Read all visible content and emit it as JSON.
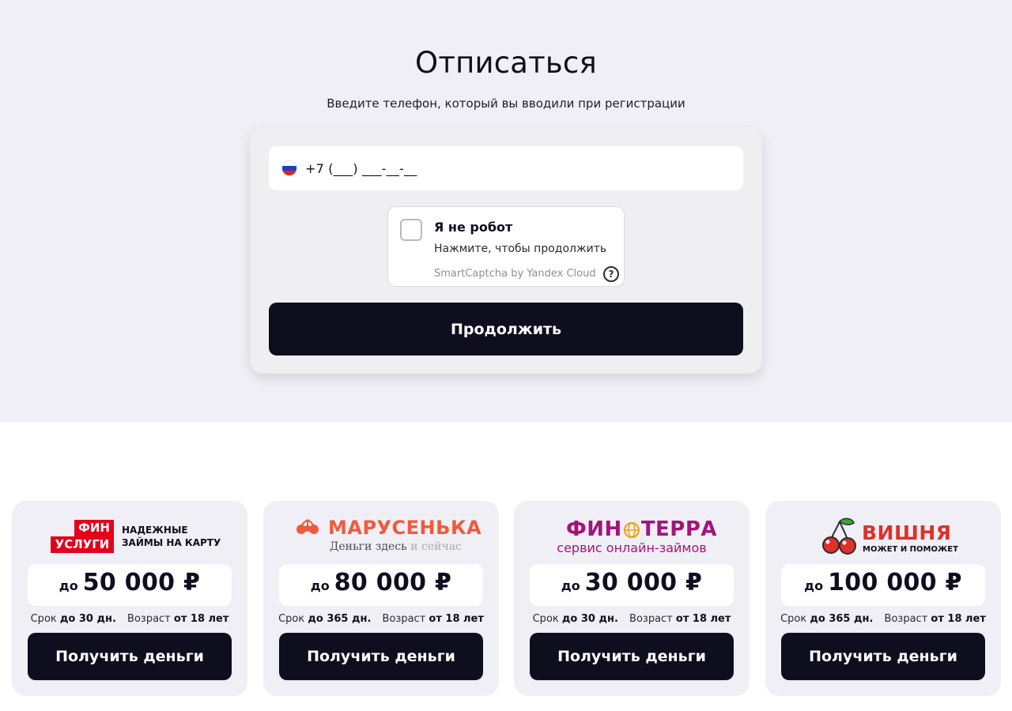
{
  "header": {
    "title": "Отписаться",
    "subtitle": "Введите телефон, который вы вводили при регистрации"
  },
  "form": {
    "phone_placeholder": "+7 (___) ___-__-__",
    "captcha": {
      "title": "Я не робот",
      "subtitle": "Нажмите, чтобы продолжить",
      "brand": "SmartCaptcha by Yandex Cloud",
      "help_icon": "question-icon",
      "help_symbol": "?"
    },
    "continue_label": "Продолжить"
  },
  "offers": [
    {
      "brand": "ФИН УСЛУГИ",
      "logo_line1": "ФИН",
      "logo_line2": "УСЛУГИ",
      "tagline_1": "НАДЕЖНЫЕ",
      "tagline_2": "ЗАЙМЫ НА КАРТУ",
      "amount_prefix": "до",
      "amount": "50 000 ₽",
      "term_label": "Срок",
      "term_value": "до 30 дн.",
      "age_label": "Возраст",
      "age_value": "от 18 лет",
      "button": "Получить деньги"
    },
    {
      "brand": "МАРУСЕНЬКА",
      "slogan_main": "Деньги здесь",
      "slogan_light": "и сейчас",
      "amount_prefix": "до",
      "amount": "80 000 ₽",
      "term_label": "Срок",
      "term_value": "до 365 дн.",
      "age_label": "Возраст",
      "age_value": "от 18 лет",
      "button": "Получить деньги"
    },
    {
      "brand_part1": "ФИН",
      "brand_part2": "ТЕРРА",
      "subtitle": "сервис онлайн-займов",
      "amount_prefix": "до",
      "amount": "30 000 ₽",
      "term_label": "Срок",
      "term_value": "до 30 дн.",
      "age_label": "Возраст",
      "age_value": "от 18 лет",
      "button": "Получить деньги"
    },
    {
      "brand": "ВИШНЯ",
      "subtitle": "МОЖЕТ И ПОМОЖЕТ",
      "amount_prefix": "до",
      "amount": "100 000 ₽",
      "term_label": "Срок",
      "term_value": "до 365 дн.",
      "age_label": "Возраст",
      "age_value": "от 18 лет",
      "button": "Получить деньги"
    }
  ],
  "colors": {
    "dark": "#0f0e1f",
    "hero_bg": "#f0eff5",
    "finuslugi_red": "#e3001b",
    "marusenka_orange": "#ee5b3b",
    "finterra_purple": "#a3147a",
    "vishnya_red": "#e0302a"
  },
  "icons": [
    "russia-flag-icon",
    "checkbox-icon",
    "question-icon",
    "berries-icon",
    "globe-icon",
    "cherry-icon"
  ]
}
